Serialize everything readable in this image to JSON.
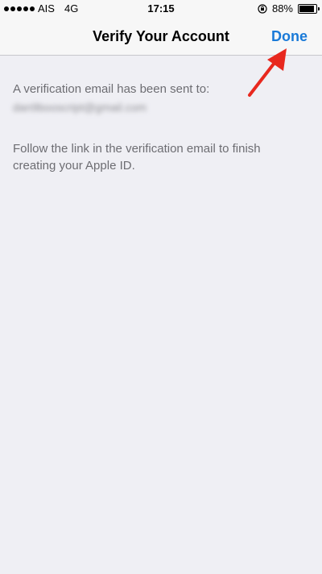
{
  "status_bar": {
    "carrier": "AIS",
    "network": "4G",
    "time": "17:15",
    "battery_percent": "88%",
    "battery_level": 0.88
  },
  "nav": {
    "title": "Verify Your Account",
    "done_label": "Done"
  },
  "content": {
    "sent_label": "A verification email has been sent to:",
    "email": "dan9booscript@gmail.com",
    "instructions": "Follow the link in the verification email to finish creating your Apple ID."
  },
  "colors": {
    "accent": "#1a7ad8",
    "arrow": "#e8281e",
    "background": "#efeff4"
  }
}
